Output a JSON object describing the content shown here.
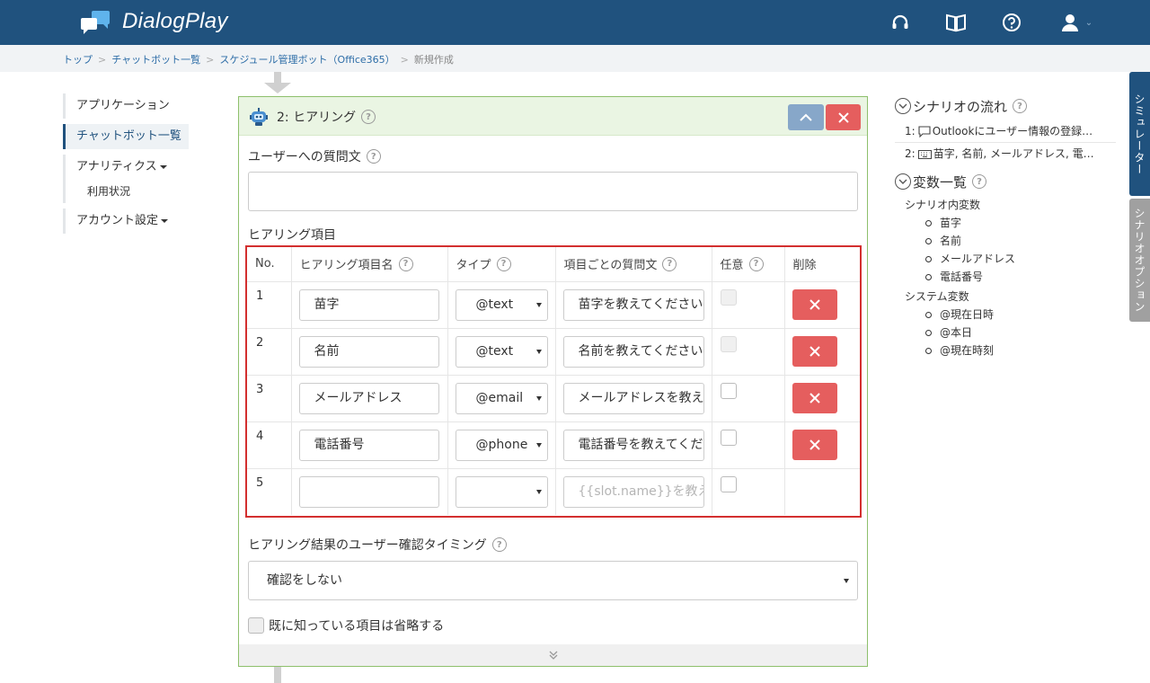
{
  "app": {
    "title": "DialogPlay"
  },
  "breadcrumb": [
    {
      "label": "トップ"
    },
    {
      "label": "チャットボット一覧"
    },
    {
      "label": "スケジュール管理ボット（Office365）"
    },
    {
      "label": "新規作成"
    }
  ],
  "sidebar": {
    "items": [
      {
        "label": "アプリケーション"
      },
      {
        "label": "チャットボット一覧"
      },
      {
        "label": "アナリティクス"
      },
      {
        "label": "利用状況"
      },
      {
        "label": "アカウント設定"
      }
    ]
  },
  "card": {
    "title": "2: ヒアリング",
    "question_label": "ユーザーへの質問文",
    "question_value": "",
    "items_label": "ヒアリング項目",
    "columns": [
      "No.",
      "ヒアリング項目名",
      "タイプ",
      "項目ごとの質問文",
      "任意",
      "削除"
    ],
    "rows": [
      {
        "no": "1",
        "name": "苗字",
        "type": "@text",
        "question": "苗字を教えてください",
        "optional": false,
        "deletable": true
      },
      {
        "no": "2",
        "name": "名前",
        "type": "@text",
        "question": "名前を教えてください",
        "optional": false,
        "deletable": true
      },
      {
        "no": "3",
        "name": "メールアドレス",
        "type": "@email",
        "question": "メールアドレスを教えてください",
        "optional": false,
        "deletable": true
      },
      {
        "no": "4",
        "name": "電話番号",
        "type": "@phone",
        "question": "電話番号を教えてください",
        "optional": false,
        "deletable": true
      },
      {
        "no": "5",
        "name": "",
        "type": "",
        "question_placeholder": "{{slot.name}}を教えてください",
        "optional": false,
        "deletable": false
      }
    ],
    "timing_label": "ヒアリング結果のユーザー確認タイミング",
    "timing_value": "確認をしない",
    "skip_label": "既に知っている項目は省略する"
  },
  "right_panel": {
    "flow_title": "シナリオの流れ",
    "flow_items": [
      {
        "label": "1: ",
        "text": "Outlookにユーザー情報の登録をお願いします"
      },
      {
        "label": "2: ",
        "text": "苗字, 名前, メールアドレス, 電話番号"
      }
    ],
    "vars_title": "変数一覧",
    "scenario_vars_label": "シナリオ内変数",
    "scenario_vars": [
      "苗字",
      "名前",
      "メールアドレス",
      "電話番号"
    ],
    "system_vars_label": "システム変数",
    "system_vars": [
      "@現在日時",
      "@本日",
      "@現在時刻"
    ]
  },
  "side_tabs": {
    "simulator": "シミュレーター",
    "options": "シナリオオプション"
  },
  "colors": {
    "header": "#20527e",
    "accent_danger": "#e55e5e",
    "card_border": "#8ec06c",
    "highlight": "#d32f2f"
  }
}
